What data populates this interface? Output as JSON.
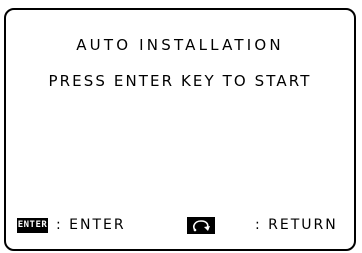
{
  "screen": {
    "title": "AUTO INSTALLATION",
    "message": "PRESS ENTER KEY TO START"
  },
  "footer": {
    "enter_key_text": "ENTER",
    "enter_label": ": ENTER",
    "return_key_icon": "return-arrow-icon",
    "return_label": ": RETURN"
  }
}
